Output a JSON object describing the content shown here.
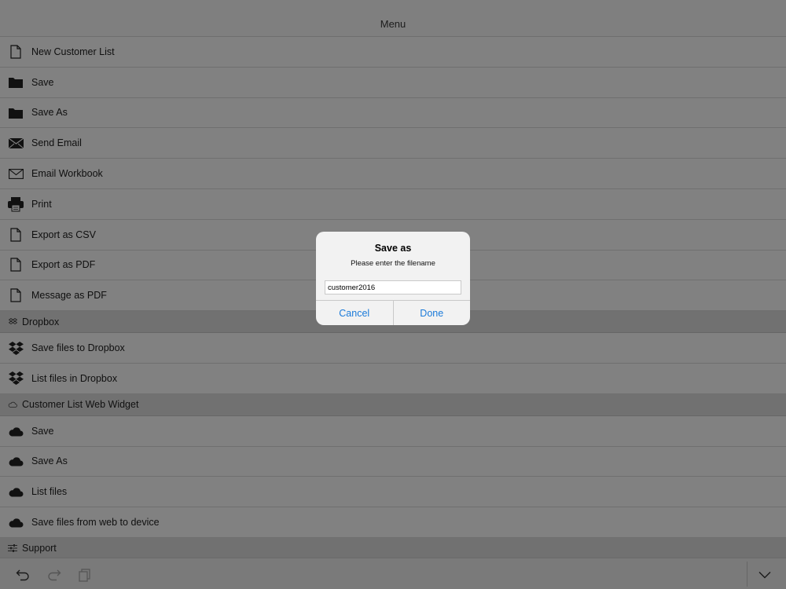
{
  "header": {
    "title": "Menu"
  },
  "menu": {
    "items": [
      {
        "label": "New Customer List",
        "icon": "document-icon"
      },
      {
        "label": "Save",
        "icon": "folder-icon"
      },
      {
        "label": "Save As",
        "icon": "folder-icon"
      },
      {
        "label": "Send Email",
        "icon": "envelope-filled-icon"
      },
      {
        "label": "Email Workbook",
        "icon": "envelope-outline-icon"
      },
      {
        "label": "Print",
        "icon": "printer-icon"
      },
      {
        "label": "Export as CSV",
        "icon": "document-icon"
      },
      {
        "label": "Export as PDF",
        "icon": "document-icon"
      },
      {
        "label": "Message as PDF",
        "icon": "document-icon"
      }
    ],
    "dropbox": {
      "title": "Dropbox",
      "items": [
        {
          "label": "Save files to Dropbox",
          "icon": "dropbox-icon"
        },
        {
          "label": "List files in Dropbox",
          "icon": "dropbox-icon"
        }
      ]
    },
    "web_widget": {
      "title": "Customer List Web Widget",
      "items": [
        {
          "label": "Save",
          "icon": "cloud-icon"
        },
        {
          "label": "Save As",
          "icon": "cloud-icon"
        },
        {
          "label": "List files",
          "icon": "cloud-icon"
        },
        {
          "label": "Save files from web to device",
          "icon": "cloud-icon"
        }
      ]
    },
    "support": {
      "title": "Support"
    }
  },
  "toolbar": {
    "undo_icon": "undo-icon",
    "redo_icon": "redo-icon",
    "copy_icon": "copy-icon",
    "collapse_icon": "chevron-down-icon"
  },
  "dialog": {
    "title": "Save as",
    "message": "Please enter the filename",
    "filename": "customer2016",
    "cancel_label": "Cancel",
    "done_label": "Done"
  },
  "colors": {
    "accent": "#1a7ad9",
    "overlay": "#808080",
    "dialog_bg": "#f2f2f2"
  }
}
